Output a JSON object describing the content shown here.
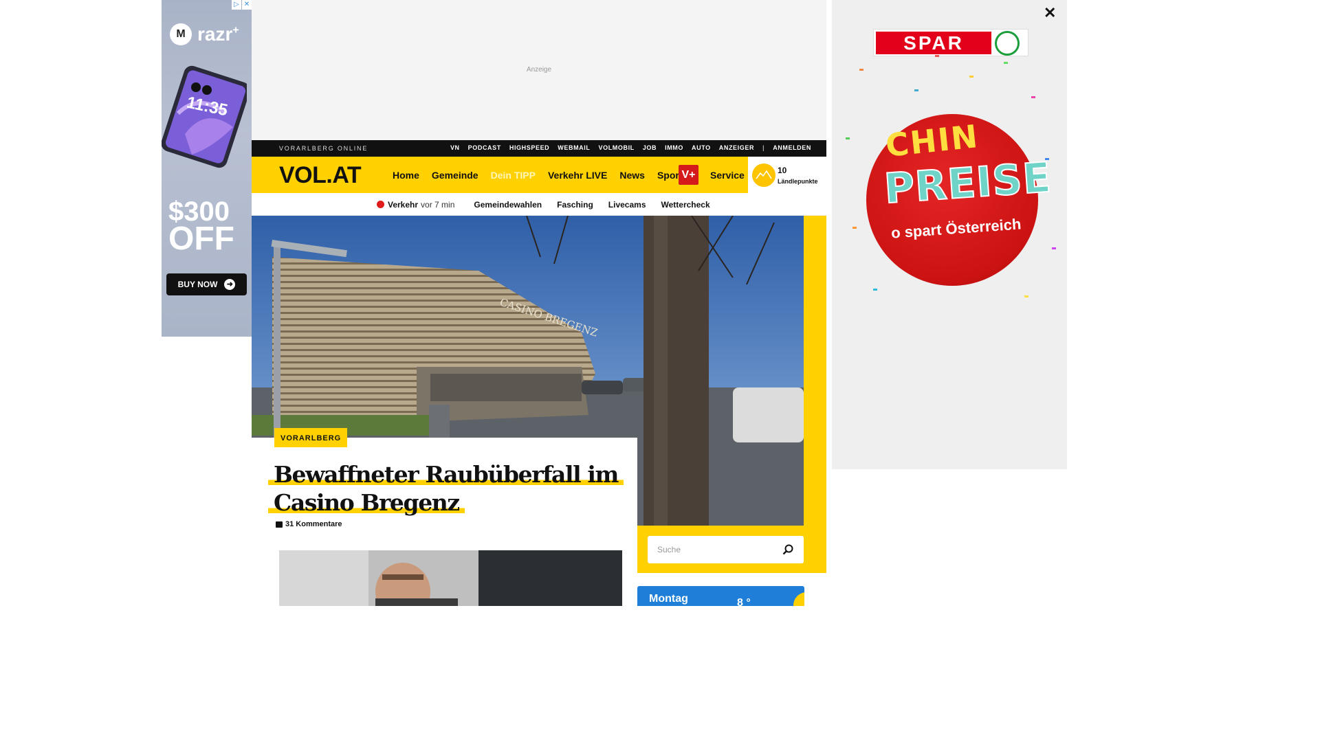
{
  "colors": {
    "brand_yellow": "#ffd100",
    "topbar": "#111111",
    "vplus_red": "#d41a1a",
    "live_red": "#e01b1b",
    "weather_blue": "#1f7fd8",
    "spar_red": "#e2001a"
  },
  "left_ad": {
    "adchoices": [
      "▷",
      "✕"
    ],
    "brand": "razr",
    "brand_sup": "+",
    "logo_icon": "motorola-icon",
    "phone_time": "11:35",
    "price": "$300",
    "price_suffix": "OFF",
    "cta": "BUY NOW"
  },
  "top_ad": {
    "label": "Anzeige"
  },
  "utilbar": {
    "site_name": "VORARLBERG ONLINE",
    "links": [
      "VN",
      "PODCAST",
      "HIGHSPEED",
      "WEBMAIL",
      "VOLMOBIL",
      "JOB",
      "IMMO",
      "AUTO",
      "ANZEIGER",
      "ANMELDEN"
    ],
    "separator": "|"
  },
  "mainnav": {
    "logo": "VOL.AT",
    "items": [
      "Home",
      "Gemeinde",
      "Dein TIPP",
      "Verkehr LIVE",
      "News",
      "Sport"
    ],
    "vplus": "V+",
    "service": "Service",
    "points_value": "10",
    "points_label": "Ländlepunkte"
  },
  "subnav": {
    "live_label": "Verkehr",
    "live_time": "vor 7 min",
    "items": [
      "Gemeindewahlen",
      "Fasching",
      "Livecams",
      "Wettercheck"
    ]
  },
  "hero": {
    "sign_text": "CASINO BREGENZ"
  },
  "article": {
    "category": "VORARLBERG",
    "headline_line1": "Bewaffneter Raubüberfall im",
    "headline_line2": "Casino Bregenz",
    "comments": "31 Kommentare"
  },
  "search": {
    "placeholder": "Suche"
  },
  "weather": {
    "day": "Montag",
    "temp": "8 °"
  },
  "right_ad": {
    "close": "✕",
    "brand": "SPAR",
    "campaign_line1": "CHIN",
    "campaign_line2": "PREISE",
    "campaign_line3": "o spart Österreich"
  }
}
